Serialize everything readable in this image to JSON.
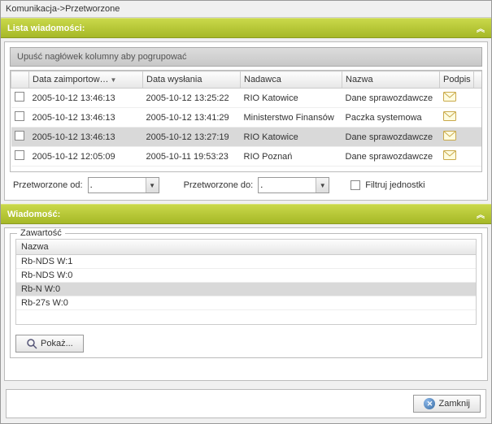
{
  "breadcrumb": "Komunikacja->Przetworzone",
  "sections": {
    "list_title": "Lista wiadomości:",
    "msg_title": "Wiadomość:"
  },
  "group_hint": "Upuść nagłówek kolumny aby pogrupować",
  "columns": {
    "imported": "Data zaimportow…",
    "sent": "Data wysłania",
    "sender": "Nadawca",
    "name": "Nazwa",
    "sig": "Podpis"
  },
  "rows": [
    {
      "imported": "2005-10-12 13:46:13",
      "sent": "2005-10-12 13:25:22",
      "sender": "RIO Katowice",
      "name": "Dane sprawozdawcze",
      "selected": false
    },
    {
      "imported": "2005-10-12 13:46:13",
      "sent": "2005-10-12 13:41:29",
      "sender": "Ministerstwo Finansów",
      "name": "Paczka systemowa",
      "selected": false
    },
    {
      "imported": "2005-10-12 13:46:13",
      "sent": "2005-10-12 13:27:19",
      "sender": "RIO Katowice",
      "name": "Dane sprawozdawcze",
      "selected": true
    },
    {
      "imported": "2005-10-12 12:05:09",
      "sent": "2005-10-11 19:53:23",
      "sender": "RIO Poznań",
      "name": "Dane sprawozdawcze",
      "selected": false
    }
  ],
  "filter": {
    "from_label": "Przetworzone od:",
    "to_label": "Przetworzone do:",
    "from_value": ".",
    "to_value": ".",
    "units_label": "Filtruj jednostki"
  },
  "content": {
    "legend": "Zawartość",
    "col": "Nazwa",
    "items": [
      {
        "label": "Rb-NDS   W:1",
        "selected": false
      },
      {
        "label": "Rb-NDS   W:0",
        "selected": false
      },
      {
        "label": "Rb-N   W:0",
        "selected": true
      },
      {
        "label": "Rb-27s   W:0",
        "selected": false
      }
    ]
  },
  "buttons": {
    "show": "Pokaż...",
    "close": "Zamknij"
  }
}
